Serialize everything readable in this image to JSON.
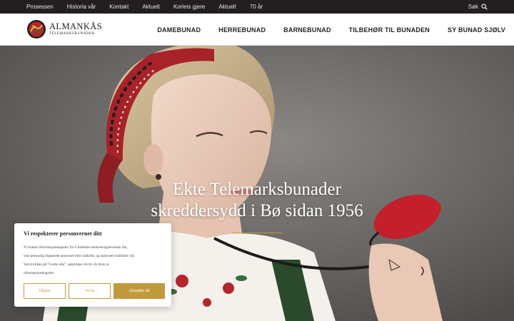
{
  "topbar": {
    "links": [
      "Prosessen",
      "Historia vår",
      "Kontakt",
      "Aktuelt",
      "Korleis gjere",
      "Aktuelt",
      "70 år"
    ],
    "search_label": "Søk",
    "search_icon": "search-icon"
  },
  "header": {
    "logo_name": "ALMANKÅS",
    "logo_sub": "TELEMARKSBUNADER",
    "nav": [
      "DAMEBUNAD",
      "HERREBUNAD",
      "BARNEBUNAD",
      "TILBEHØR TIL BUNADEN",
      "SY BUNAD SJØLV"
    ]
  },
  "hero": {
    "title_line1": "Ekte Telemarksbunader",
    "title_line2": "skreddersydd i Bø sidan 1956"
  },
  "cookie": {
    "title": "Vi respekterer personvernet ditt",
    "body_lines": [
      "Vi bruker informasjonskapsler for å forbedre nettleseropplevelsen din,",
      "vise personlig tilpassede annonser eller innhold, og analysere trafikken vår.",
      "Ved å klikke på \"Godta alle\", samtykker du til vår bruk av",
      "informasjonskapsler."
    ],
    "buttons": {
      "customize": "Tilpass",
      "reject": "Avvis",
      "accept": "Aksepter alt"
    }
  },
  "colors": {
    "accent_gold": "#c19a3d",
    "topbar_bg": "#231f20",
    "logo_red": "#b4262b"
  }
}
